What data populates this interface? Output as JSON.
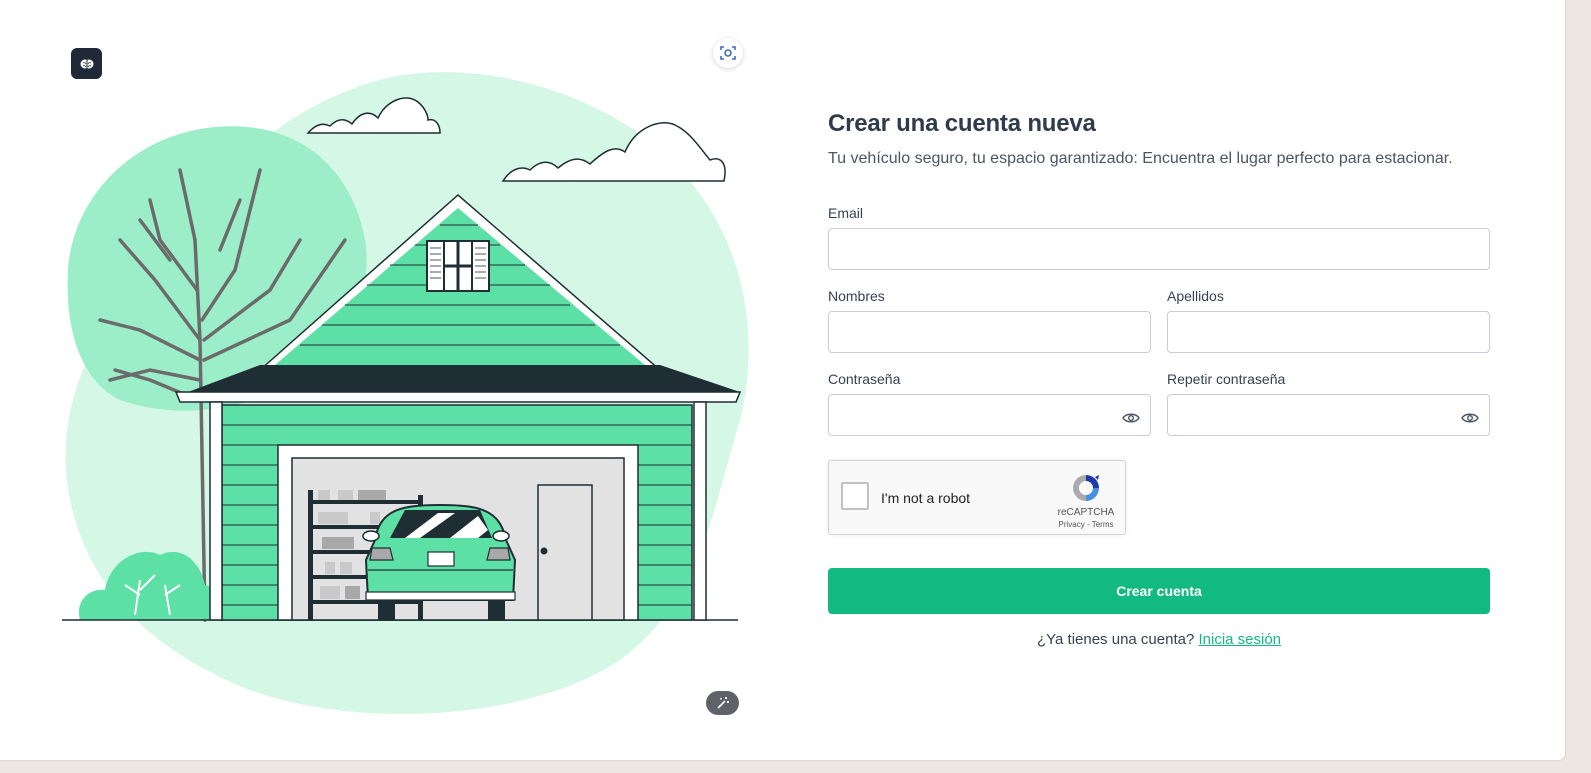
{
  "colors": {
    "accent": "#12ba82",
    "illustration_green": "#5ce0a6",
    "illustration_light": "#d4f7e6",
    "illustration_dark": "#1f2d35"
  },
  "icons": {
    "logo": "brain-icon",
    "scan": "scan-icon",
    "magic": "magic-wand-icon",
    "password_toggle": "eye-icon",
    "recaptcha": "recaptcha-icon"
  },
  "form": {
    "title": "Crear una cuenta nueva",
    "subtitle": "Tu vehículo seguro, tu espacio garantizado: Encuentra el lugar perfecto para estacionar.",
    "email": {
      "label": "Email",
      "value": ""
    },
    "first_name": {
      "label": "Nombres",
      "value": ""
    },
    "last_name": {
      "label": "Apellidos",
      "value": ""
    },
    "password": {
      "label": "Contraseña",
      "value": ""
    },
    "password_repeat": {
      "label": "Repetir contraseña",
      "value": ""
    },
    "recaptcha": {
      "checkbox_label": "I'm not a robot",
      "brand": "reCAPTCHA",
      "privacy": "Privacy",
      "separator": " - ",
      "terms": "Terms"
    },
    "submit_label": "Crear cuenta",
    "login_prompt": "¿Ya tienes una cuenta?",
    "login_link": "Inicia sesión"
  }
}
